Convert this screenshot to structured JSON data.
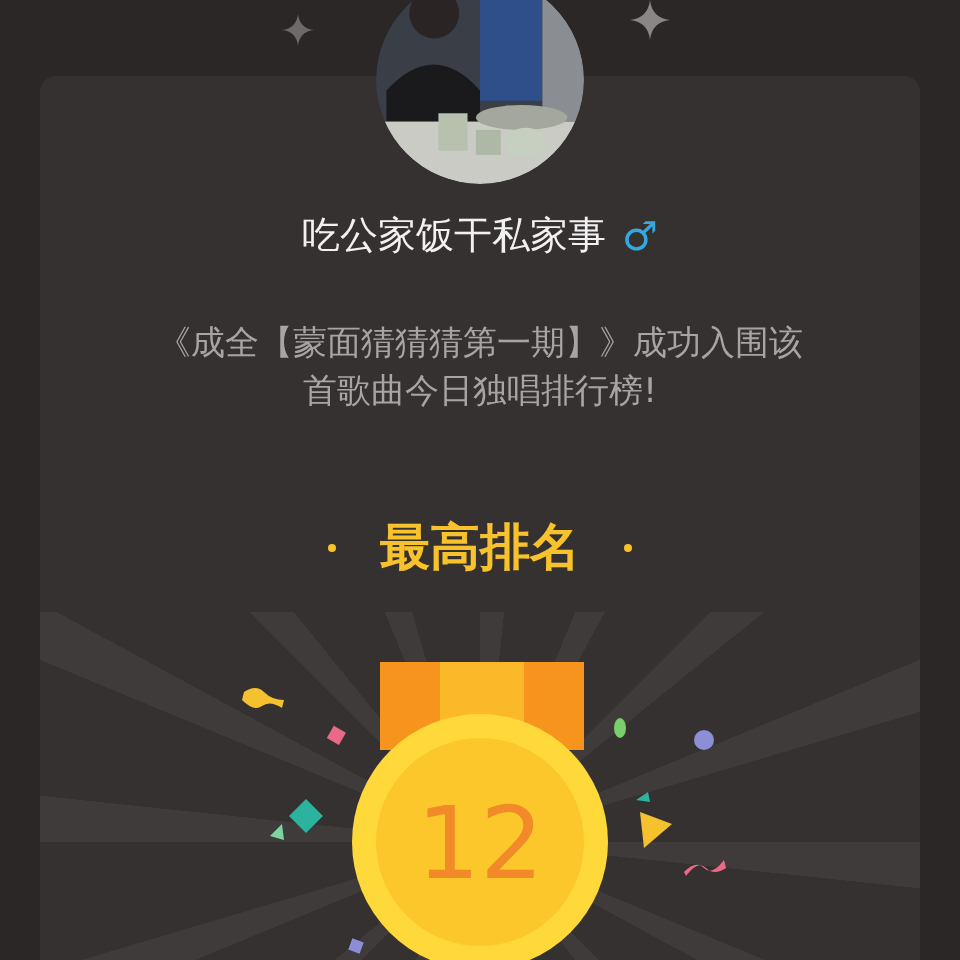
{
  "user": {
    "name": "吃公家饭干私家事",
    "gender": "♂"
  },
  "message": "《成全【蒙面猜猜猜第一期】》成功入围该首歌曲今日独唱排行榜!",
  "rank_title": "最高排名",
  "rank": "12"
}
